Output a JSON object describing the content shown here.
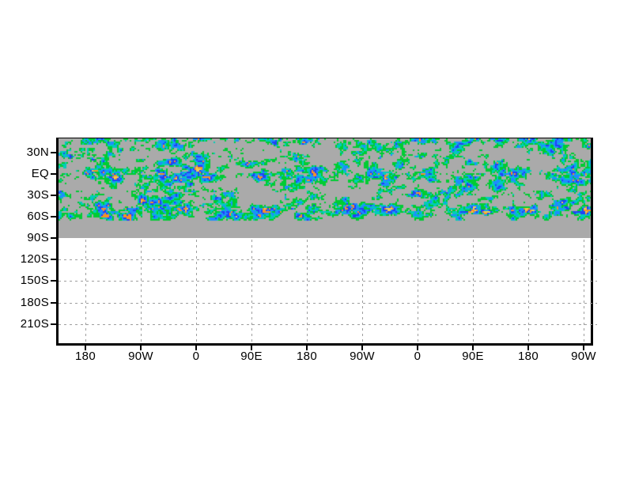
{
  "window": {
    "background_color": "#ffffff"
  },
  "chart_data": {
    "type": "heatmap",
    "title": "",
    "xlabel": "",
    "ylabel": "",
    "x_ticks": [
      "180",
      "90W",
      "0",
      "90E",
      "180",
      "90W",
      "0",
      "90E",
      "180",
      "90W"
    ],
    "y_ticks": [
      "30N",
      "EQ",
      "30S",
      "60S",
      "90S",
      "120S",
      "150S",
      "180S",
      "210S"
    ],
    "legend": "none",
    "grid": "dotted gray gridlines in the empty lower half; hidden behind the gray data band in the upper half",
    "axis_color": "#000000",
    "gridline_color": "#9e9e9e",
    "background_band_color": "#aaaaaa",
    "band_extent": "gray data band spans full width from above 30N down to 90S; shaded field fills it from the top edge to roughly 65S; area below 90S is empty white with dotted gridlines",
    "field": {
      "kind": "pseudorandom shaded grid-point field (~2px cells) over gray background",
      "structure": "speckled green field with cyan/blue clusters; orange-yellow hotspots concentrated near the EQ band and near the 55S-65S band; quieter gray gaps in between",
      "seed": 1337,
      "thresholds": [
        0.52,
        0.6,
        0.655,
        0.725,
        0.785,
        0.85
      ]
    },
    "palette": [
      {
        "name": "green",
        "color": "#00cc33"
      },
      {
        "name": "cyan",
        "color": "#00cdb9"
      },
      {
        "name": "light-blue",
        "color": "#1e8cff"
      },
      {
        "name": "dark-blue",
        "color": "#2341f5"
      },
      {
        "name": "orange",
        "color": "#f59128"
      },
      {
        "name": "yellow",
        "color": "#f0cd50"
      }
    ]
  }
}
